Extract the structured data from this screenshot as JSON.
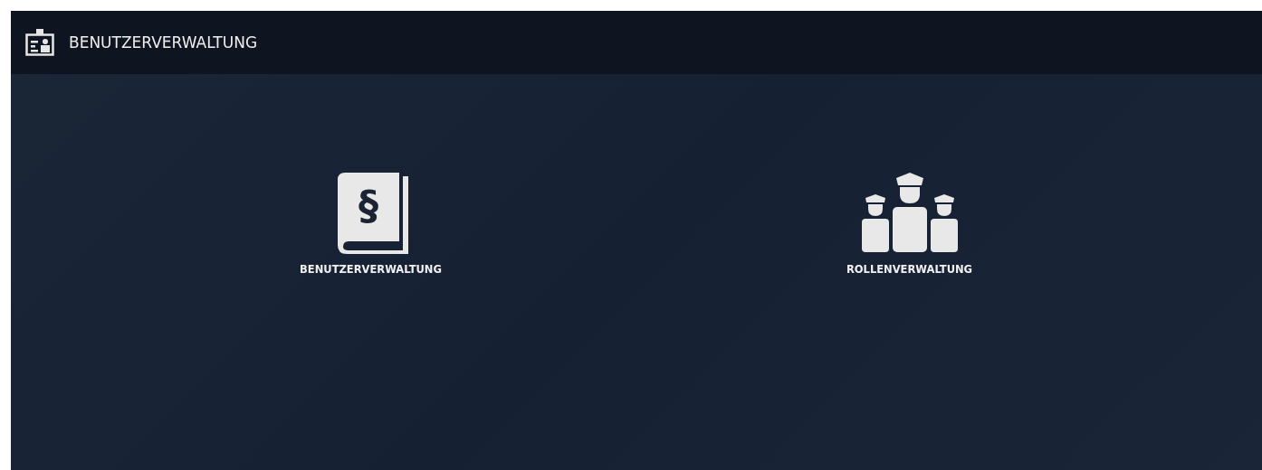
{
  "header": {
    "title": "BENUTZERVERWALTUNG"
  },
  "tiles": [
    {
      "kind": "book",
      "symbol": "§",
      "label": "BENUTZERVERWALTUNG"
    },
    {
      "kind": "officers",
      "label": "ROLLENVERWALTUNG"
    }
  ]
}
